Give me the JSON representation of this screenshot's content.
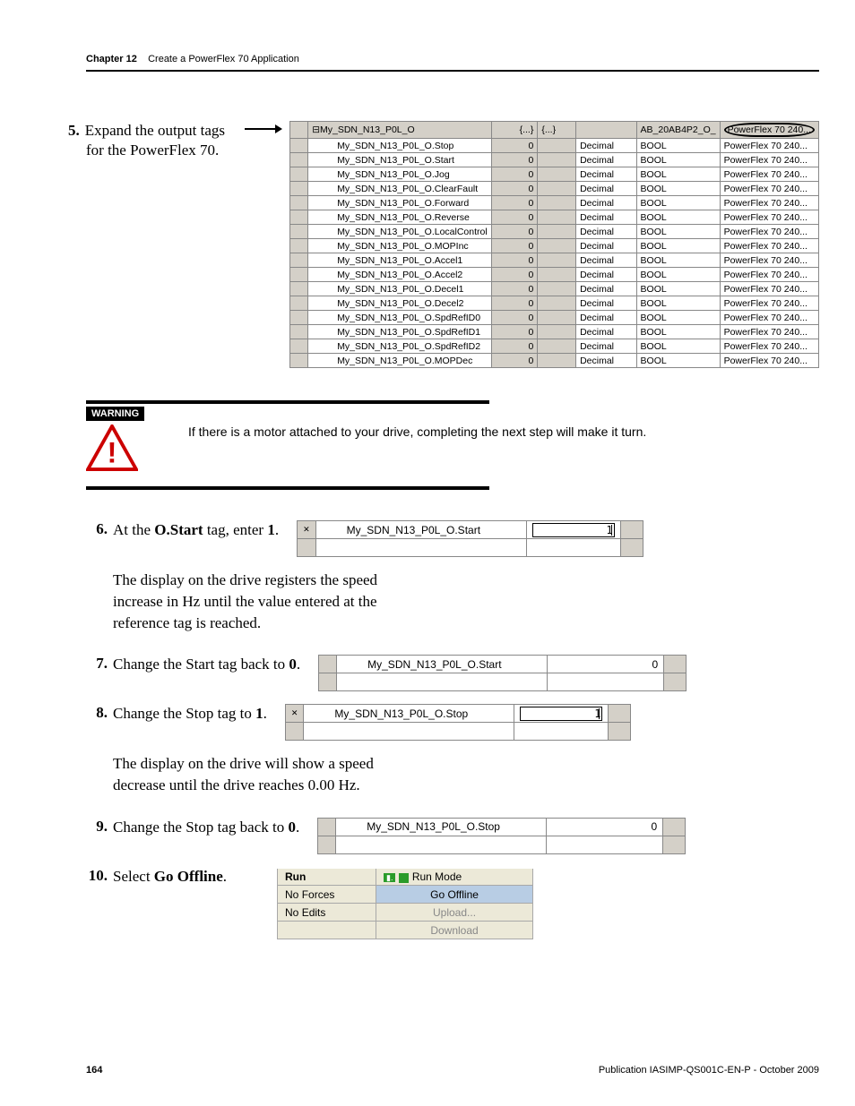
{
  "header": {
    "chapter": "Chapter 12",
    "title": "Create a PowerFlex 70 Application"
  },
  "step5": {
    "num": "5.",
    "text1": "Expand the output tags for the PowerFlex 70.",
    "table": {
      "root": "My_SDN_N13_P0L_O",
      "col2": "{...}",
      "col3": "{...}",
      "col5": "AB_20AB4P2_O_",
      "desc": "PowerFlex 70 240...",
      "rows": [
        {
          "name": "My_SDN_N13_P0L_O.Stop",
          "v": "0",
          "style": "Decimal",
          "t": "BOOL",
          "d": "PowerFlex 70 240..."
        },
        {
          "name": "My_SDN_N13_P0L_O.Start",
          "v": "0",
          "style": "Decimal",
          "t": "BOOL",
          "d": "PowerFlex 70 240..."
        },
        {
          "name": "My_SDN_N13_P0L_O.Jog",
          "v": "0",
          "style": "Decimal",
          "t": "BOOL",
          "d": "PowerFlex 70 240..."
        },
        {
          "name": "My_SDN_N13_P0L_O.ClearFault",
          "v": "0",
          "style": "Decimal",
          "t": "BOOL",
          "d": "PowerFlex 70 240..."
        },
        {
          "name": "My_SDN_N13_P0L_O.Forward",
          "v": "0",
          "style": "Decimal",
          "t": "BOOL",
          "d": "PowerFlex 70 240..."
        },
        {
          "name": "My_SDN_N13_P0L_O.Reverse",
          "v": "0",
          "style": "Decimal",
          "t": "BOOL",
          "d": "PowerFlex 70 240..."
        },
        {
          "name": "My_SDN_N13_P0L_O.LocalControl",
          "v": "0",
          "style": "Decimal",
          "t": "BOOL",
          "d": "PowerFlex 70 240..."
        },
        {
          "name": "My_SDN_N13_P0L_O.MOPInc",
          "v": "0",
          "style": "Decimal",
          "t": "BOOL",
          "d": "PowerFlex 70 240..."
        },
        {
          "name": "My_SDN_N13_P0L_O.Accel1",
          "v": "0",
          "style": "Decimal",
          "t": "BOOL",
          "d": "PowerFlex 70 240..."
        },
        {
          "name": "My_SDN_N13_P0L_O.Accel2",
          "v": "0",
          "style": "Decimal",
          "t": "BOOL",
          "d": "PowerFlex 70 240..."
        },
        {
          "name": "My_SDN_N13_P0L_O.Decel1",
          "v": "0",
          "style": "Decimal",
          "t": "BOOL",
          "d": "PowerFlex 70 240..."
        },
        {
          "name": "My_SDN_N13_P0L_O.Decel2",
          "v": "0",
          "style": "Decimal",
          "t": "BOOL",
          "d": "PowerFlex 70 240..."
        },
        {
          "name": "My_SDN_N13_P0L_O.SpdRefID0",
          "v": "0",
          "style": "Decimal",
          "t": "BOOL",
          "d": "PowerFlex 70 240..."
        },
        {
          "name": "My_SDN_N13_P0L_O.SpdRefID1",
          "v": "0",
          "style": "Decimal",
          "t": "BOOL",
          "d": "PowerFlex 70 240..."
        },
        {
          "name": "My_SDN_N13_P0L_O.SpdRefID2",
          "v": "0",
          "style": "Decimal",
          "t": "BOOL",
          "d": "PowerFlex 70 240..."
        },
        {
          "name": "My_SDN_N13_P0L_O.MOPDec",
          "v": "0",
          "style": "Decimal",
          "t": "BOOL",
          "d": "PowerFlex 70 240..."
        }
      ]
    }
  },
  "warning": {
    "label": "WARNING",
    "text": "If there is a motor attached to your drive, completing the next step will make it turn."
  },
  "step6": {
    "num": "6.",
    "pre": "At the ",
    "bold": "O.Start",
    "post": " tag, enter ",
    "val": "1",
    "end": ".",
    "strip": {
      "label": "My_SDN_N13_P0L_O.Start",
      "value": "1"
    }
  },
  "para6": "The display on the drive registers the speed increase in Hz until the value entered at the reference tag is reached.",
  "step7": {
    "num": "7.",
    "pre": "Change the Start tag back to ",
    "val": "0",
    "end": ".",
    "strip": {
      "label": "My_SDN_N13_P0L_O.Start",
      "value": "0"
    }
  },
  "step8": {
    "num": "8.",
    "pre": "Change the Stop tag to ",
    "val": "1",
    "end": ".",
    "strip": {
      "label": "My_SDN_N13_P0L_O.Stop",
      "value": "1"
    }
  },
  "para8": "The display on the drive will show a speed decrease until the drive reaches 0.00 Hz.",
  "step9": {
    "num": "9.",
    "pre": "Change the Stop tag back to ",
    "val": "0",
    "end": ".",
    "strip": {
      "label": "My_SDN_N13_P0L_O.Stop",
      "value": "0"
    }
  },
  "step10": {
    "num": "10.",
    "pre": "Select ",
    "bold": "Go Offline",
    "end": "."
  },
  "menu": {
    "run": "Run",
    "runmode": "Run Mode",
    "noforces": "No Forces",
    "gooffline": "Go Offline",
    "noedits": "No Edits",
    "upload": "Upload...",
    "download": "Download"
  },
  "footer": {
    "page": "164",
    "pub": "Publication IASIMP-QS001C-EN-P - October 2009"
  }
}
